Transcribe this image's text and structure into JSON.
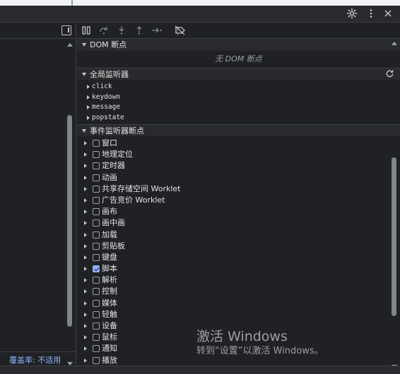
{
  "titlebar": {
    "settings_icon": "gear-icon",
    "more_icon": "more-vertical-icon",
    "close_icon": "close-icon"
  },
  "left_pane": {
    "toggle_icon": "toggle-sidebar-icon",
    "coverage_label": "覆盖率:",
    "coverage_value": "不适用"
  },
  "debug_toolbar": {
    "buttons": [
      "pause-icon",
      "step-over-icon",
      "step-into-icon",
      "step-out-icon",
      "step-icon",
      "deactivate-breakpoints-icon"
    ]
  },
  "dom_breakpoints": {
    "title": "DOM 断点",
    "empty_message": "无 DOM 断点"
  },
  "global_listeners": {
    "title": "全局监听器",
    "refresh_icon": "refresh-icon",
    "items": [
      "click",
      "keydown",
      "message",
      "popstate"
    ]
  },
  "event_breakpoints": {
    "title": "事件监听器断点",
    "items": [
      {
        "label": "窗口",
        "checked": false
      },
      {
        "label": "地理定位",
        "checked": false
      },
      {
        "label": "定时器",
        "checked": false
      },
      {
        "label": "动画",
        "checked": false
      },
      {
        "label": "共享存储空间 Worklet",
        "checked": false
      },
      {
        "label": "广告竞价 Worklet",
        "checked": false
      },
      {
        "label": "画布",
        "checked": false
      },
      {
        "label": "画中画",
        "checked": false
      },
      {
        "label": "加载",
        "checked": false
      },
      {
        "label": "剪贴板",
        "checked": false
      },
      {
        "label": "键盘",
        "checked": false
      },
      {
        "label": "脚本",
        "checked": true
      },
      {
        "label": "解析",
        "checked": false
      },
      {
        "label": "控制",
        "checked": false
      },
      {
        "label": "媒体",
        "checked": false
      },
      {
        "label": "轻触",
        "checked": false
      },
      {
        "label": "设备",
        "checked": false
      },
      {
        "label": "鼠标",
        "checked": false
      },
      {
        "label": "通知",
        "checked": false
      },
      {
        "label": "播放",
        "checked": false
      }
    ]
  },
  "watermark": {
    "line1": "激活 Windows",
    "line2": "转到“设置”以激活 Windows。"
  },
  "colors": {
    "background": "#202124",
    "header": "#292a2d",
    "accent": "#8ab4f8",
    "text": "#e3e3e3"
  }
}
